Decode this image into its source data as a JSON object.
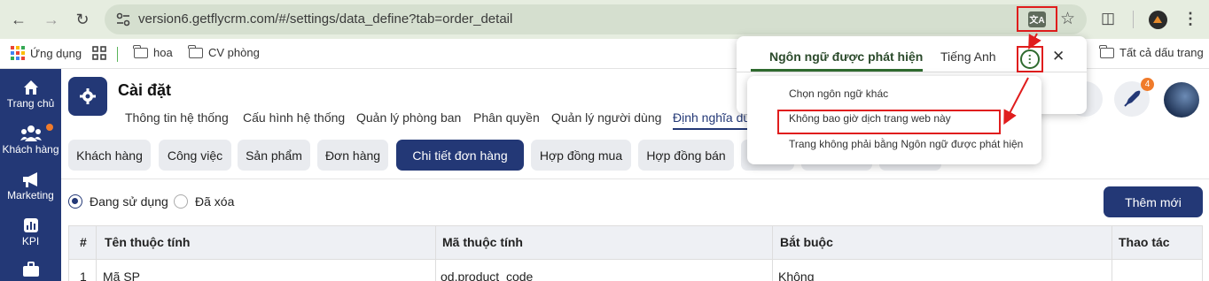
{
  "browser": {
    "url": "version6.getflycrm.com/#/settings/data_define?tab=order_detail",
    "bookmarks": {
      "apps_label": "Ứng dụng",
      "items": [
        "hoa",
        "CV phòng"
      ],
      "all_bookmarks": "Tất cả dấu trang"
    }
  },
  "sidebar": {
    "items": [
      {
        "label": "Trang chủ",
        "icon": "home-icon"
      },
      {
        "label": "Khách hàng",
        "icon": "users-icon"
      },
      {
        "label": "Marketing",
        "icon": "megaphone-icon"
      },
      {
        "label": "KPI",
        "icon": "chart-icon"
      },
      {
        "label": "",
        "icon": "briefcase-icon"
      }
    ]
  },
  "header": {
    "title": "Cài đặt",
    "tabs": [
      "Thông tin hệ thống",
      "Cấu hình hệ thống",
      "Quản lý phòng ban",
      "Phân quyền",
      "Quản lý người dùng",
      "Định nghĩa dữ"
    ],
    "notification_count": "4"
  },
  "subtabs": [
    "Khách hàng",
    "Công việc",
    "Sản phẩm",
    "Đơn hàng",
    "Chi tiết đơn hàng",
    "Hợp đồng mua",
    "Hợp đồng bán"
  ],
  "filter": {
    "options": [
      "Đang sử dụng",
      "Đã xóa"
    ],
    "selected": "Đang sử dụng",
    "add_button": "Thêm mới"
  },
  "table": {
    "headers": [
      "#",
      "Tên thuộc tính",
      "Mã thuộc tính",
      "Bắt buộc",
      "Thao tác"
    ],
    "rows": [
      [
        "1",
        "Mã SP",
        "od.product_code",
        "Không",
        ""
      ]
    ]
  },
  "translate_popup": {
    "tabs": [
      "Ngôn ngữ được phát hiện",
      "Tiếng Anh"
    ],
    "menu": [
      "Chọn ngôn ngữ khác",
      "Không bao giờ dịch trang web này",
      "Trang không phải bằng Ngôn ngữ được phát hiện"
    ]
  },
  "colors": {
    "primary": "#233876",
    "accent_orange": "#f07b2b",
    "annotation_red": "#e01d1d",
    "chrome_green": "#2f6b2f"
  }
}
